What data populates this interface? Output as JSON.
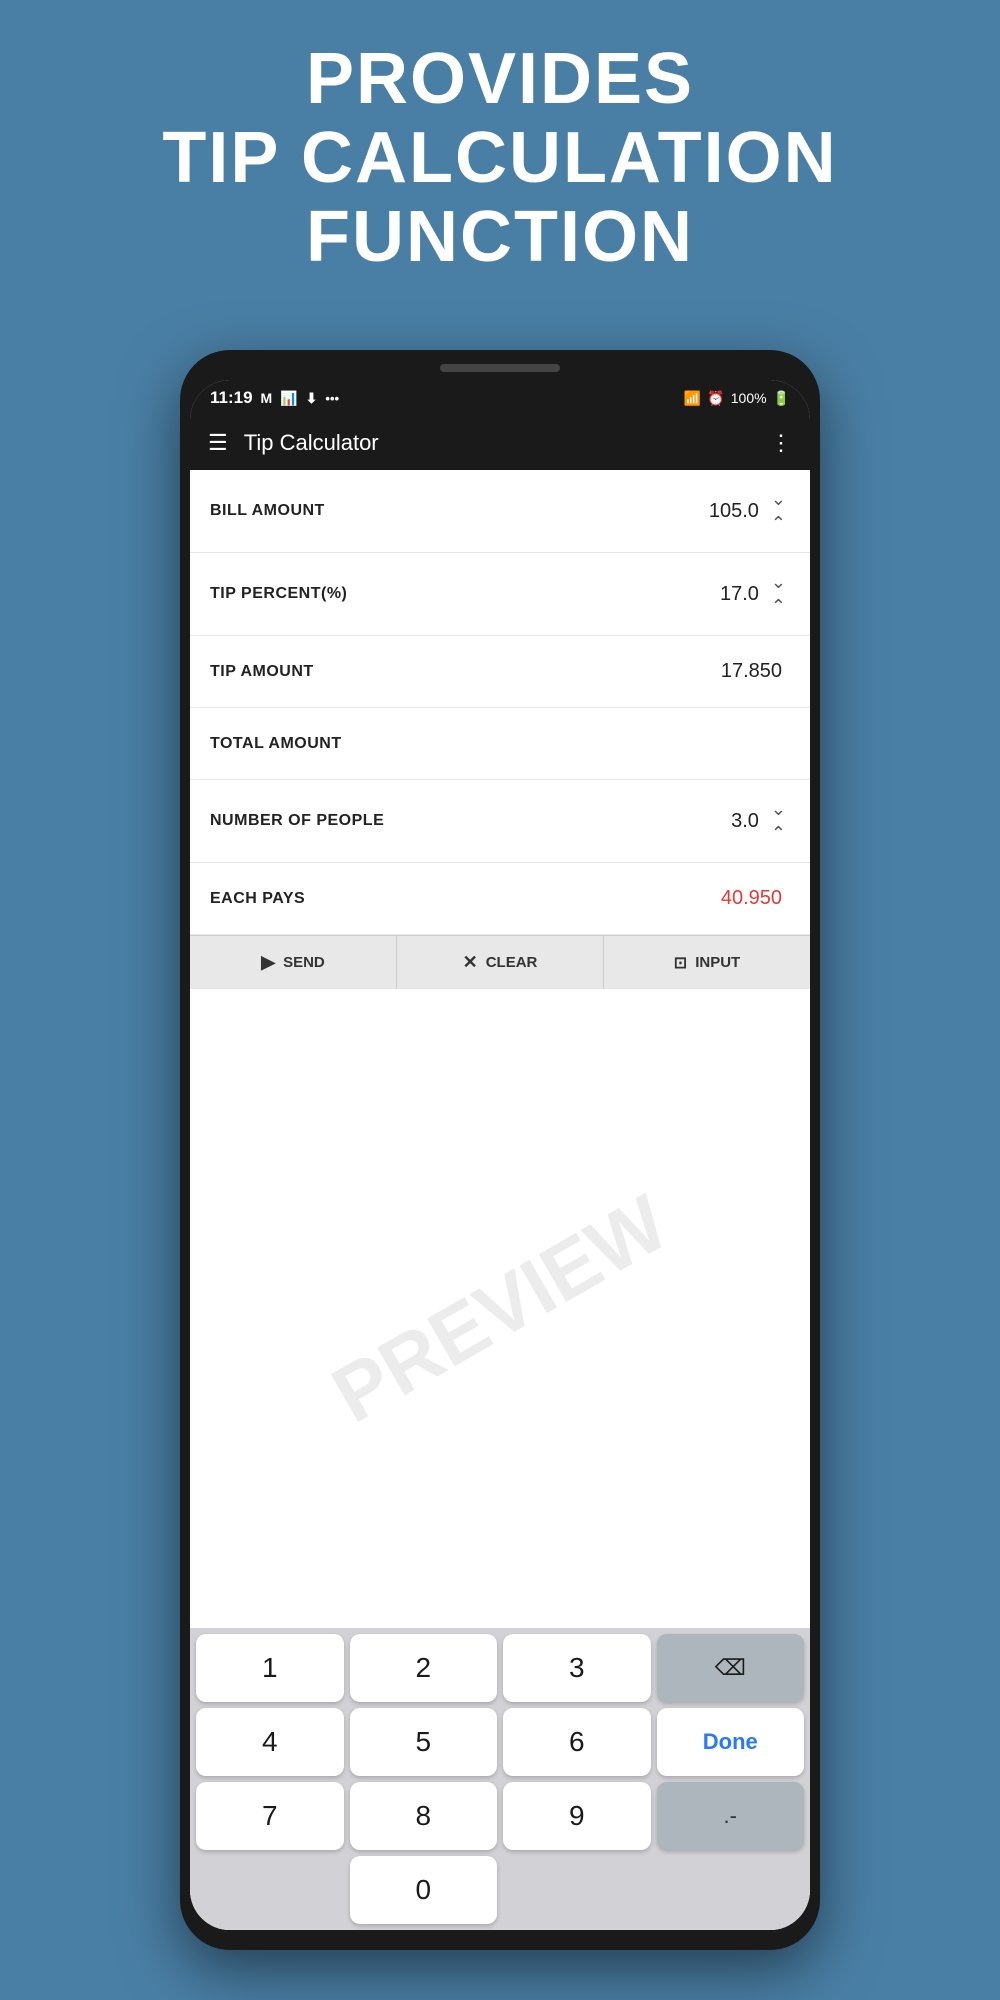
{
  "hero": {
    "line1": "PROVIDES",
    "line2": "TIP CALCULATION",
    "line3": "FUNCTION"
  },
  "status_bar": {
    "time": "11:19",
    "battery": "100%",
    "signal": "WiFi"
  },
  "app_bar": {
    "title": "Tip Calculator",
    "menu_icon": "☰",
    "more_icon": "⋮"
  },
  "calc_rows": [
    {
      "label": "BILL AMOUNT",
      "value": "105.0",
      "has_stepper": true,
      "value_color": "normal"
    },
    {
      "label": "TIP PERCENT(%)",
      "value": "17.0",
      "has_stepper": true,
      "value_color": "normal"
    },
    {
      "label": "TIP AMOUNT",
      "value": "17.850",
      "has_stepper": false,
      "value_color": "normal"
    },
    {
      "label": "TOTAL AMOUNT",
      "value": "",
      "has_stepper": false,
      "value_color": "normal"
    },
    {
      "label": "NUMBER OF PEOPLE",
      "value": "3.0",
      "has_stepper": true,
      "value_color": "normal"
    },
    {
      "label": "EACH PAYS",
      "value": "40.950",
      "has_stepper": false,
      "value_color": "red"
    }
  ],
  "action_bar": {
    "send_label": "SEND",
    "send_icon": "▶",
    "clear_label": "CLEAR",
    "clear_icon": "✕",
    "input_label": "INPUT",
    "input_icon": "⬛"
  },
  "keyboard": {
    "rows": [
      [
        "1",
        "2",
        "3",
        "⌫"
      ],
      [
        "4",
        "5",
        "6",
        "Done"
      ],
      [
        "7",
        "8",
        "9",
        ".-"
      ],
      [
        "",
        "0",
        "",
        ""
      ]
    ]
  }
}
